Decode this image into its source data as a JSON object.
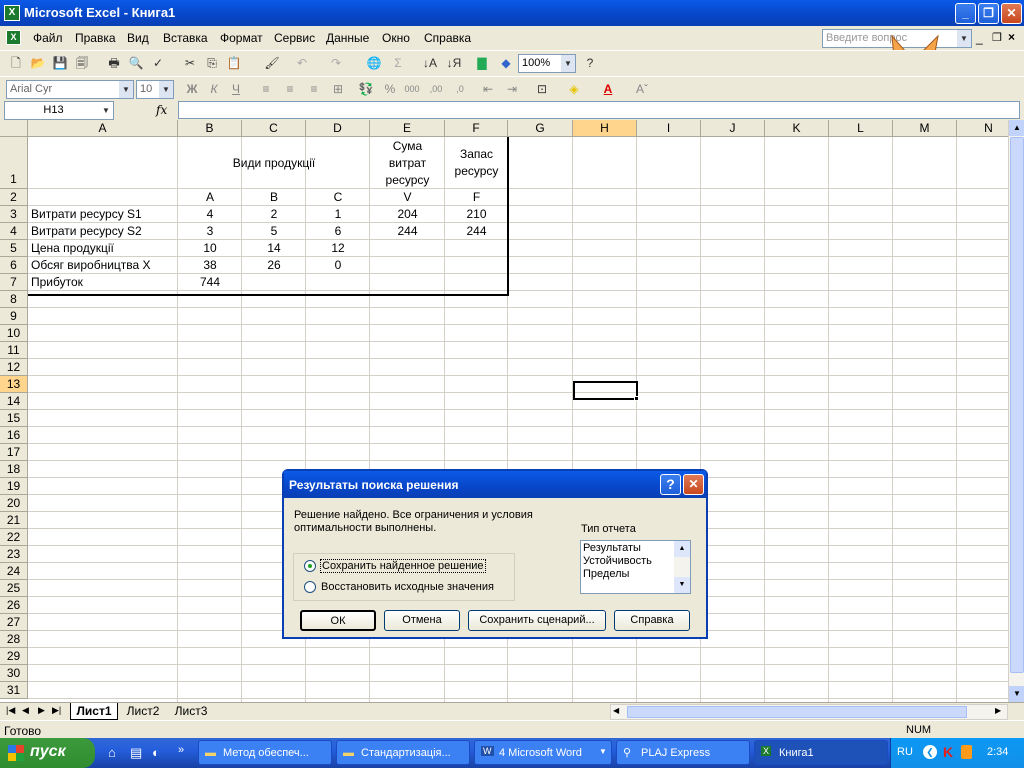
{
  "window": {
    "title": "Microsoft Excel - Книга1",
    "min": "_",
    "restore": "❐",
    "close": "✕"
  },
  "menu": [
    "Файл",
    "Правка",
    "Вид",
    "Вставка",
    "Формат",
    "Сервис",
    "Данные",
    "Окно",
    "Справка"
  ],
  "help_box": {
    "placeholder": "Введите вопрос"
  },
  "toolbar": {
    "zoom": "100%",
    "font": "Arial Cyr",
    "size": "10"
  },
  "formula": {
    "namebox": "H13",
    "fx": "fx",
    "value": ""
  },
  "columns": [
    {
      "label": "A",
      "w": 150
    },
    {
      "label": "B",
      "w": 64
    },
    {
      "label": "C",
      "w": 64
    },
    {
      "label": "D",
      "w": 64
    },
    {
      "label": "E",
      "w": 75
    },
    {
      "label": "F",
      "w": 63
    },
    {
      "label": "G",
      "w": 65
    },
    {
      "label": "H",
      "w": 64
    },
    {
      "label": "I",
      "w": 64
    },
    {
      "label": "J",
      "w": 64
    },
    {
      "label": "K",
      "w": 64
    },
    {
      "label": "L",
      "w": 64
    },
    {
      "label": "M",
      "w": 64
    },
    {
      "label": "N",
      "w": 64
    }
  ],
  "rows": [
    "1",
    "2",
    "3",
    "4",
    "5",
    "6",
    "7",
    "8",
    "9",
    "10",
    "11",
    "12",
    "13",
    "14",
    "15",
    "16",
    "17",
    "18",
    "19",
    "20",
    "21",
    "22",
    "23",
    "24",
    "25",
    "26",
    "27",
    "28",
    "29",
    "30",
    "31"
  ],
  "table": {
    "header_products": "Види продукції",
    "header_sum": [
      "Сума",
      "витрат",
      "ресурсу"
    ],
    "header_stock": [
      "Запас",
      "ресурсу"
    ],
    "row2": [
      "A",
      "B",
      "C",
      "V",
      "F"
    ],
    "row3": [
      "Витрати ресурсу S1",
      "4",
      "2",
      "1",
      "204",
      "210"
    ],
    "row4": [
      "Витрати ресурсу S2",
      "3",
      "5",
      "6",
      "244",
      "244"
    ],
    "row5": [
      "Цена продукції",
      "10",
      "14",
      "12"
    ],
    "row6": [
      "Обсяг виробництва X",
      "38",
      "26",
      "0"
    ],
    "row7": [
      "Прибуток",
      "744"
    ]
  },
  "sheets": [
    "Лист1",
    "Лист2",
    "Лист3"
  ],
  "status": {
    "left": "Готово",
    "num": "NUM"
  },
  "dialog": {
    "title": "Результаты поиска решения",
    "message": "Решение найдено. Все ограничения и условия оптимальности выполнены.",
    "report_label": "Тип отчета",
    "reports": [
      "Результаты",
      "Устойчивость",
      "Пределы"
    ],
    "radio_keep": "Сохранить найденное решение",
    "radio_restore": "Восстановить исходные значения",
    "btn_ok": "ОК",
    "btn_cancel": "Отмена",
    "btn_scenario": "Сохранить сценарий...",
    "btn_help": "Справка",
    "help_q": "?"
  },
  "taskbar": {
    "start": "пуск",
    "tasks": [
      "Метод обеспеч...",
      "Стандартизація...",
      "4 Microsoft Word",
      "PLAJ Express",
      "Книга1"
    ],
    "lang": "RU",
    "clock": "2:34"
  }
}
